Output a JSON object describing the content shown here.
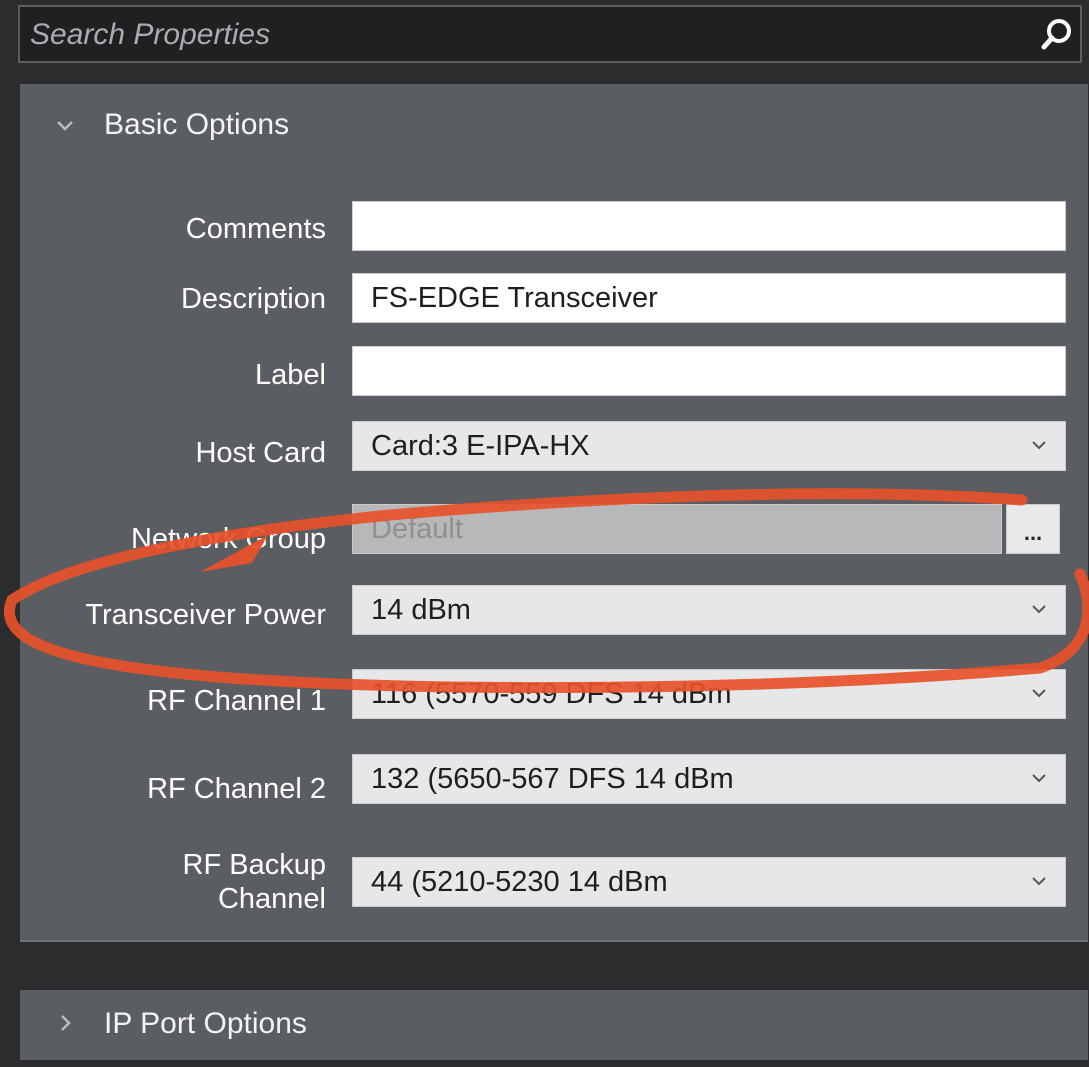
{
  "search": {
    "placeholder": "Search Properties"
  },
  "basic_options": {
    "title": "Basic Options",
    "rows": [
      {
        "label": "Comments",
        "value": ""
      },
      {
        "label": "Description",
        "value": "FS-EDGE Transceiver"
      },
      {
        "label": "Label",
        "value": ""
      },
      {
        "label": "Host Card",
        "value": "Card:3 E-IPA-HX"
      },
      {
        "label": "Network Group",
        "value": "Default",
        "button_label": "..."
      },
      {
        "label": "Transceiver Power",
        "value": "14 dBm"
      },
      {
        "label": "RF Channel 1",
        "value": "116 (5570-559 DFS 14 dBm"
      },
      {
        "label": "RF Channel 2",
        "value": "132 (5650-567 DFS 14 dBm"
      },
      {
        "label_line1": "RF Backup",
        "label_line2": "Channel",
        "value": "44 (5210-5230  14 dBm"
      }
    ]
  },
  "ip_port_options": {
    "title": "IP Port Options"
  },
  "colors": {
    "background": "#2b2c2e",
    "panel": "#5a5d61",
    "annotation_circle": "#e8512a"
  }
}
